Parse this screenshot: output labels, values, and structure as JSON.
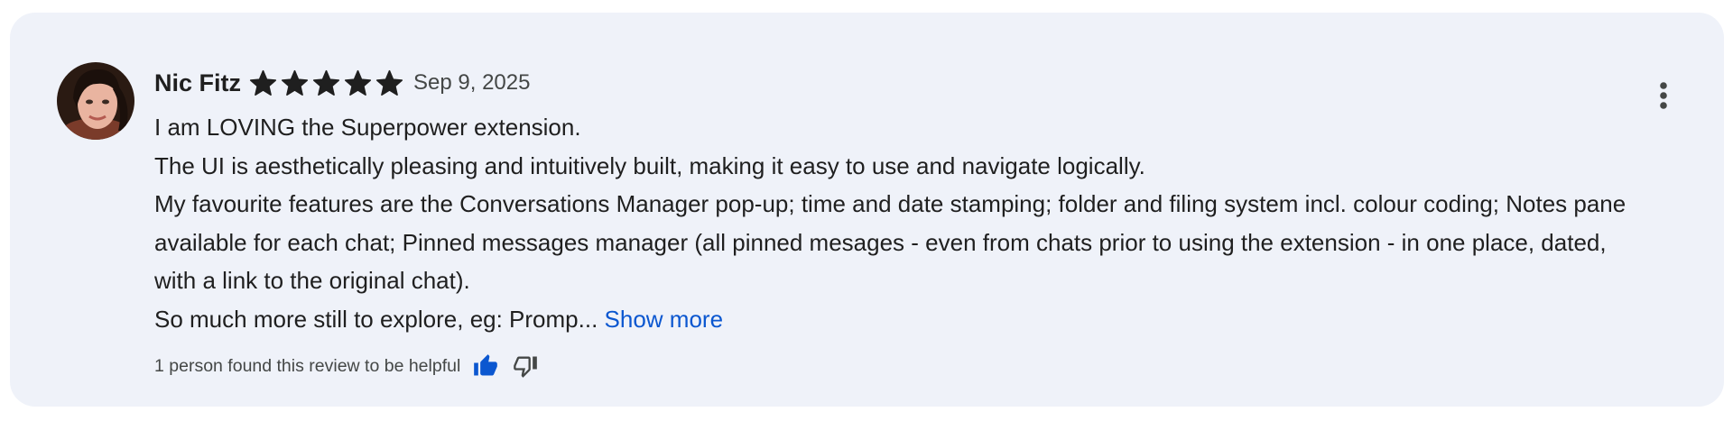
{
  "review": {
    "author": "Nic Fitz",
    "rating": 5,
    "rating_max": 5,
    "date": "Sep 9, 2025",
    "lines": [
      "I am LOVING the Superpower extension.",
      "The UI is aesthetically pleasing and intuitively built, making it easy to use and navigate logically.",
      "My favourite features are the Conversations Manager pop-up; time and date stamping; folder and filing system incl. colour coding; Notes pane available for each chat; Pinned messages manager (all pinned mesages - even from chats prior to using the extension - in one place, dated, with a link to the original chat).",
      "So much more still to explore, eg: Promp..."
    ],
    "show_more_label": "Show more",
    "helpful_text": "1 person found this review to be helpful"
  },
  "icons": {
    "star": "star-icon",
    "menu": "more-vert-icon",
    "thumbs_up": "thumb-up-filled-icon",
    "thumbs_down": "thumb-down-outline-icon"
  },
  "colors": {
    "card_background": "#eff2f9",
    "link": "#0b57d0",
    "thumbs_up_active": "#0b57d0",
    "star": "#1f1f1f"
  }
}
